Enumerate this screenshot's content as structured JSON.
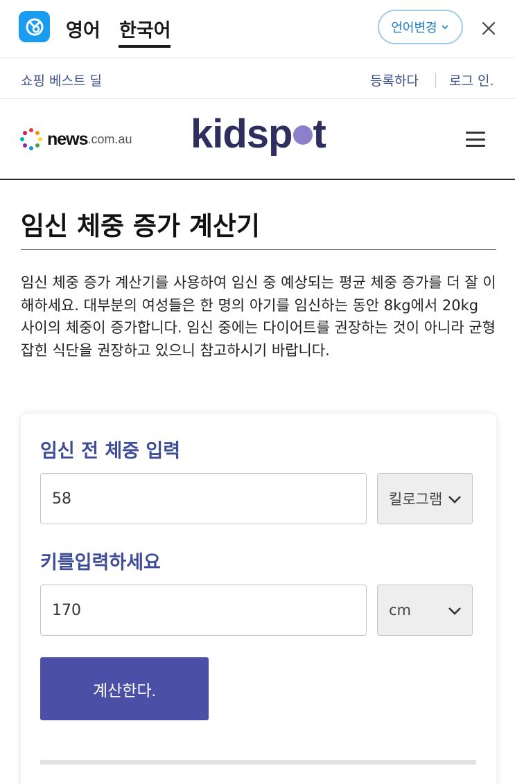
{
  "translate_bar": {
    "source_lang": "영어",
    "target_lang": "한국어",
    "change_language": "언어변경"
  },
  "util_bar": {
    "deals": "쇼핑 베스트 딜",
    "register": "등록하다",
    "login": "로그 인."
  },
  "header": {
    "news_brand": "news",
    "news_suffix": ".com.au",
    "site_brand_before": "kidsp",
    "site_brand_after": "t"
  },
  "article": {
    "title": "임신 체중 증가 계산기",
    "intro": "임신 체중 증가 계산기를 사용하여 임신 중 예상되는 평균 체중 증가를 더 잘 이해하세요. 대부분의 여성들은 한 명의 아기를 임신하는 동안 8kg에서 20kg 사이의 체중이 증가합니다. 임신 중에는 다이어트를 권장하는 것이 아니라 균형 잡힌 식단을 권장하고 있으니 참고하시기 바랍니다."
  },
  "calculator": {
    "weight_label": "임신 전 체중 입력",
    "weight_value": "58",
    "weight_unit": "킬로그램",
    "height_label": "키를입력하세요",
    "height_value": "170",
    "height_unit": "cm",
    "calculate_label": "계산한다."
  },
  "colors": {
    "accent": "#4b50a6",
    "label": "#3e4c98",
    "brand": "#2e2f5e",
    "link": "#3d4f8c",
    "translate_blue": "#1a9cf0"
  }
}
